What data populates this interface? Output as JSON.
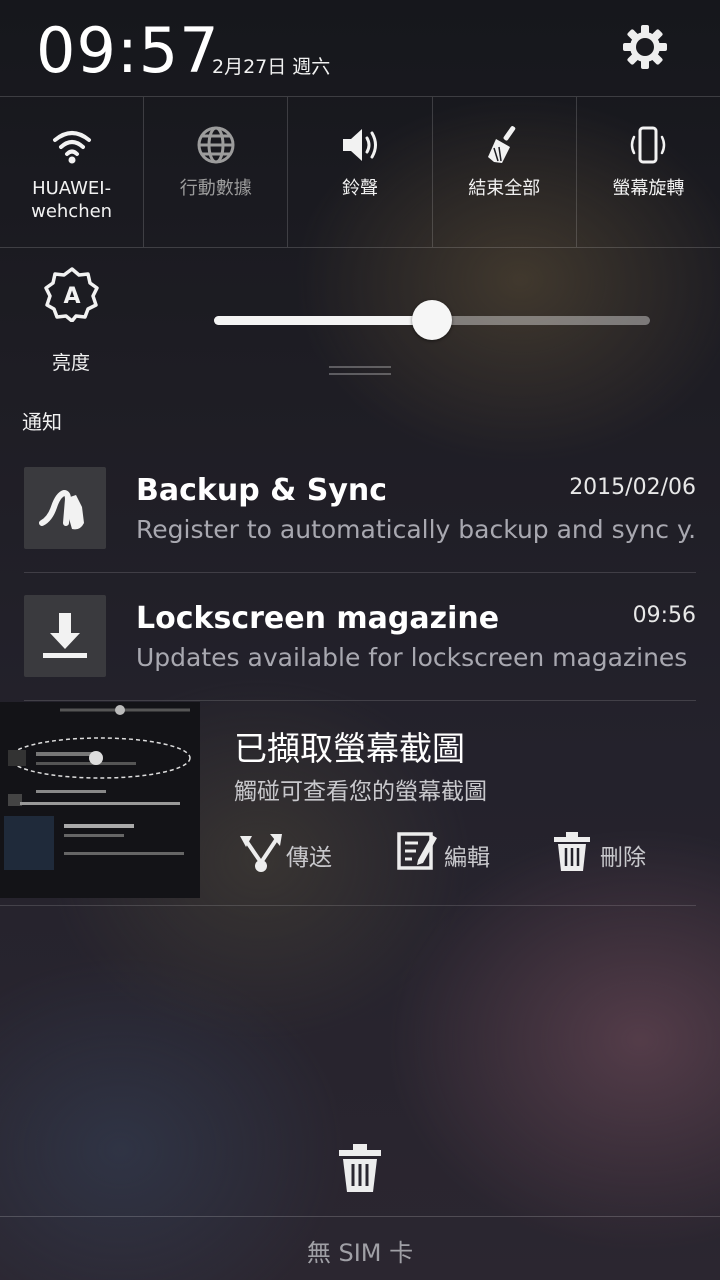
{
  "status": {
    "time": "09:57",
    "date": "2月27日 週六"
  },
  "quick_settings": [
    {
      "label": "HUAWEI-\nwehchen",
      "icon": "wifi-icon",
      "active": true
    },
    {
      "label": "行動數據",
      "icon": "globe-icon",
      "active": false
    },
    {
      "label": "鈴聲",
      "icon": "speaker-icon",
      "active": true
    },
    {
      "label": "結束全部",
      "icon": "broom-icon",
      "active": true
    },
    {
      "label": "螢幕旋轉",
      "icon": "rotate-phone-icon",
      "active": true
    }
  ],
  "brightness": {
    "label": "亮度",
    "icon": "auto-brightness-icon",
    "level": 0.5
  },
  "notifications_header": "通知",
  "notifications": [
    {
      "title": "Backup & Sync",
      "time": "2015/02/06",
      "text": "Register to automatically backup and sync y..",
      "icon": "backup-sync-icon"
    },
    {
      "title": "Lockscreen magazine",
      "time": "09:56",
      "text": "Updates available for lockscreen magazines",
      "icon": "download-icon"
    }
  ],
  "screenshot": {
    "title": "已擷取螢幕截圖",
    "subtitle": "觸碰可查看您的螢幕截圖",
    "actions": [
      {
        "label": "傳送",
        "icon": "share-icon"
      },
      {
        "label": "編輯",
        "icon": "edit-icon"
      },
      {
        "label": "刪除",
        "icon": "trash-icon"
      }
    ]
  },
  "footer": {
    "sim_status": "無 SIM 卡",
    "clear_icon": "trash-icon"
  },
  "colors": {
    "text_primary": "#ffffff",
    "text_secondary": "#a8a8b0",
    "inactive": "#9c9c9c"
  }
}
